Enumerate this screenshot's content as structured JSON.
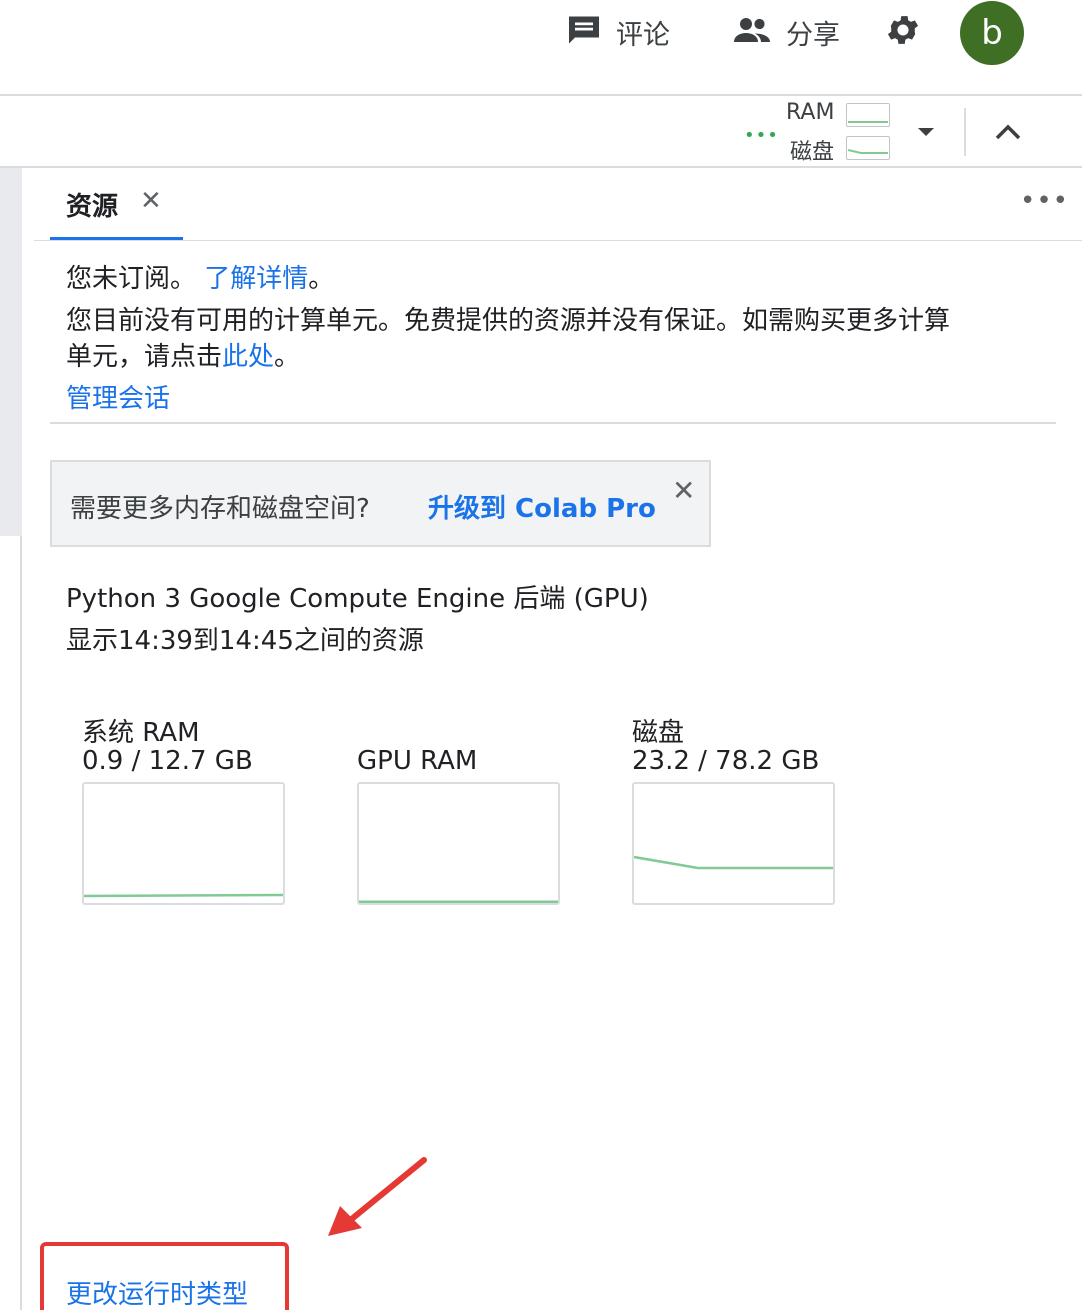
{
  "header": {
    "comment_label": "评论",
    "share_label": "分享",
    "avatar_letter": "b"
  },
  "toolbar": {
    "ram_label": "RAM",
    "disk_label": "磁盘"
  },
  "panel": {
    "tab_label": "资源",
    "tab_close": "✕",
    "more": "•••"
  },
  "info": {
    "not_subscribed": "您未订阅。",
    "learn_more": "了解详情",
    "period": "。",
    "no_units_line1": "您目前没有可用的计算单元。免费提供的资源并没有保证。如需购买更多计算",
    "no_units_line2_prefix": "单元，请点击",
    "here_link": "此处",
    "line2_suffix": "。",
    "manage_sessions": "管理会话"
  },
  "banner": {
    "text": "需要更多内存和磁盘空间?",
    "link": "升级到 Colab Pro",
    "close": "✕"
  },
  "runtime": {
    "backend": "Python 3 Google Compute Engine 后端 (GPU)",
    "time_range": "显示14:39到14:45之间的资源"
  },
  "resources": [
    {
      "name": "系统 RAM",
      "usage": "0.9 / 12.7 GB"
    },
    {
      "name": "GPU RAM",
      "usage": ""
    },
    {
      "name": "磁盘",
      "usage": "23.2 / 78.2 GB"
    }
  ],
  "footer": {
    "change_runtime": "更改运行时类型"
  },
  "colors": {
    "link": "#1a73e8",
    "graph_line": "#81c995",
    "avatar": "#3e6f24",
    "annotation": "#e53935"
  }
}
